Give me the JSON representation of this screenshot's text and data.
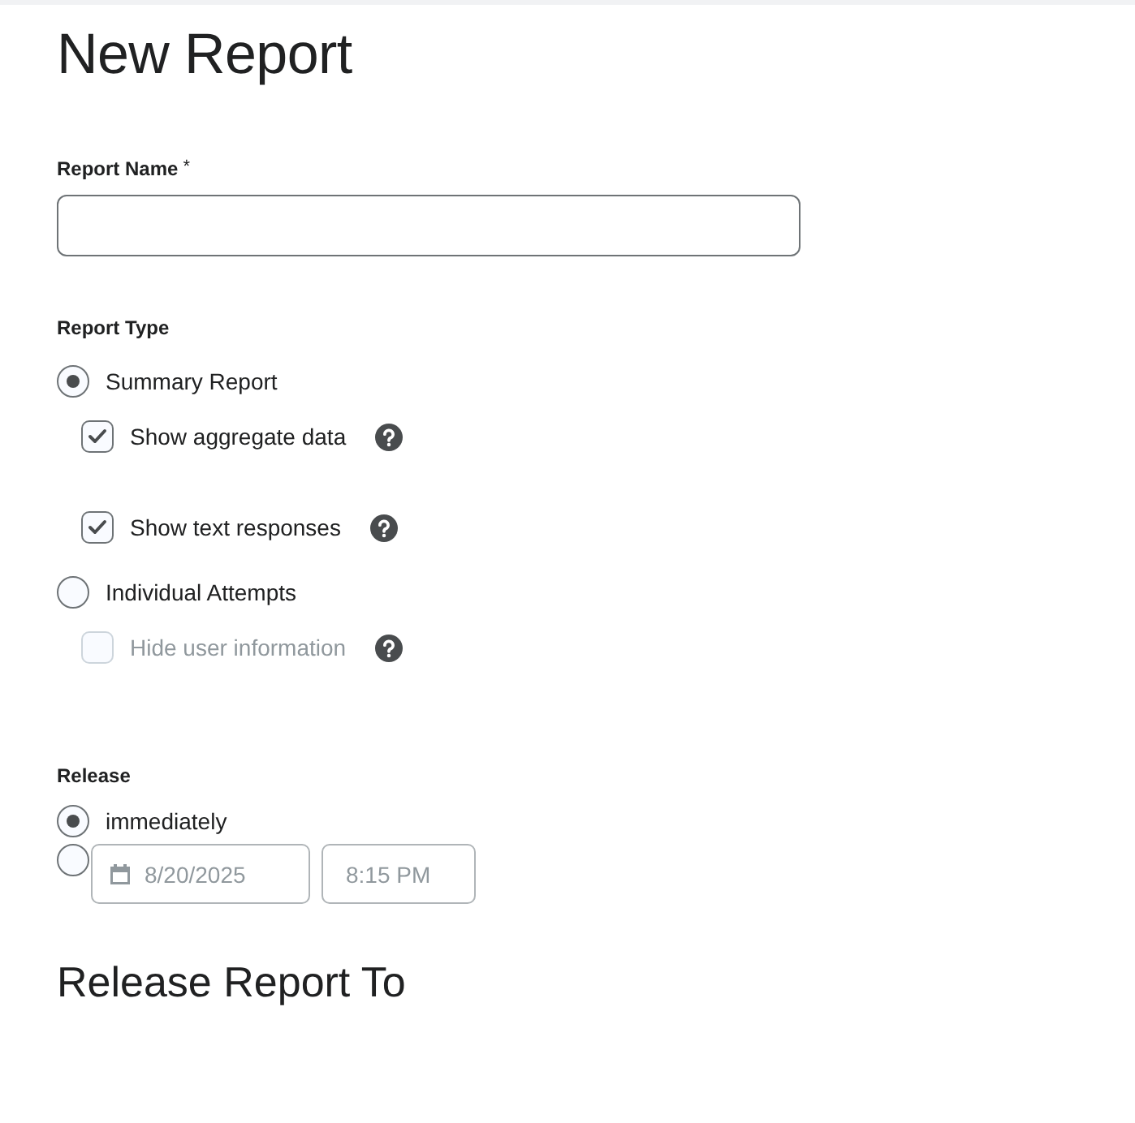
{
  "title": "New Report",
  "report_name": {
    "label": "Report Name",
    "required_mark": "*"
  },
  "report_type": {
    "label": "Report Type",
    "options": [
      {
        "label": "Summary Report",
        "selected": true,
        "suboptions": [
          {
            "label": "Show aggregate data",
            "checked": true,
            "disabled": false
          },
          {
            "label": "Show text responses",
            "checked": true,
            "disabled": false
          }
        ]
      },
      {
        "label": "Individual Attempts",
        "selected": false,
        "suboptions": [
          {
            "label": "Hide user information",
            "checked": false,
            "disabled": true
          }
        ]
      }
    ]
  },
  "release": {
    "label": "Release",
    "options": [
      {
        "kind": "text",
        "label": "immediately",
        "selected": true
      },
      {
        "kind": "datetime",
        "date": "8/20/2025",
        "time": "8:15 PM",
        "disabled": true,
        "selected": false
      }
    ]
  },
  "section_heading": "Release Report To"
}
